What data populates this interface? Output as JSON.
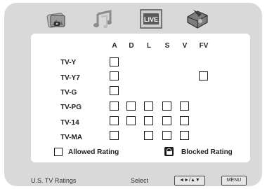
{
  "columns": [
    "A",
    "D",
    "L",
    "S",
    "V",
    "FV"
  ],
  "ratings": [
    "TV-Y",
    "TV-Y7",
    "TV-G",
    "TV-PG",
    "TV-14",
    "TV-MA"
  ],
  "legend": {
    "allowed": "Allowed Rating",
    "blocked": "Blocked Rating"
  },
  "footer": {
    "title": "U.S. TV Ratings",
    "select_label": "Select",
    "nav_key": "◄►/▲▼",
    "menu_key": "MENU"
  },
  "tabs": [
    "picture-tab",
    "audio-tab",
    "live-tab",
    "setup-tab"
  ],
  "tab_labels": {
    "live": "LIVE"
  },
  "colors": {
    "frame": "#d9d9d9",
    "panel": "#ffffff",
    "checkbox_border": "#1a1a1a"
  }
}
